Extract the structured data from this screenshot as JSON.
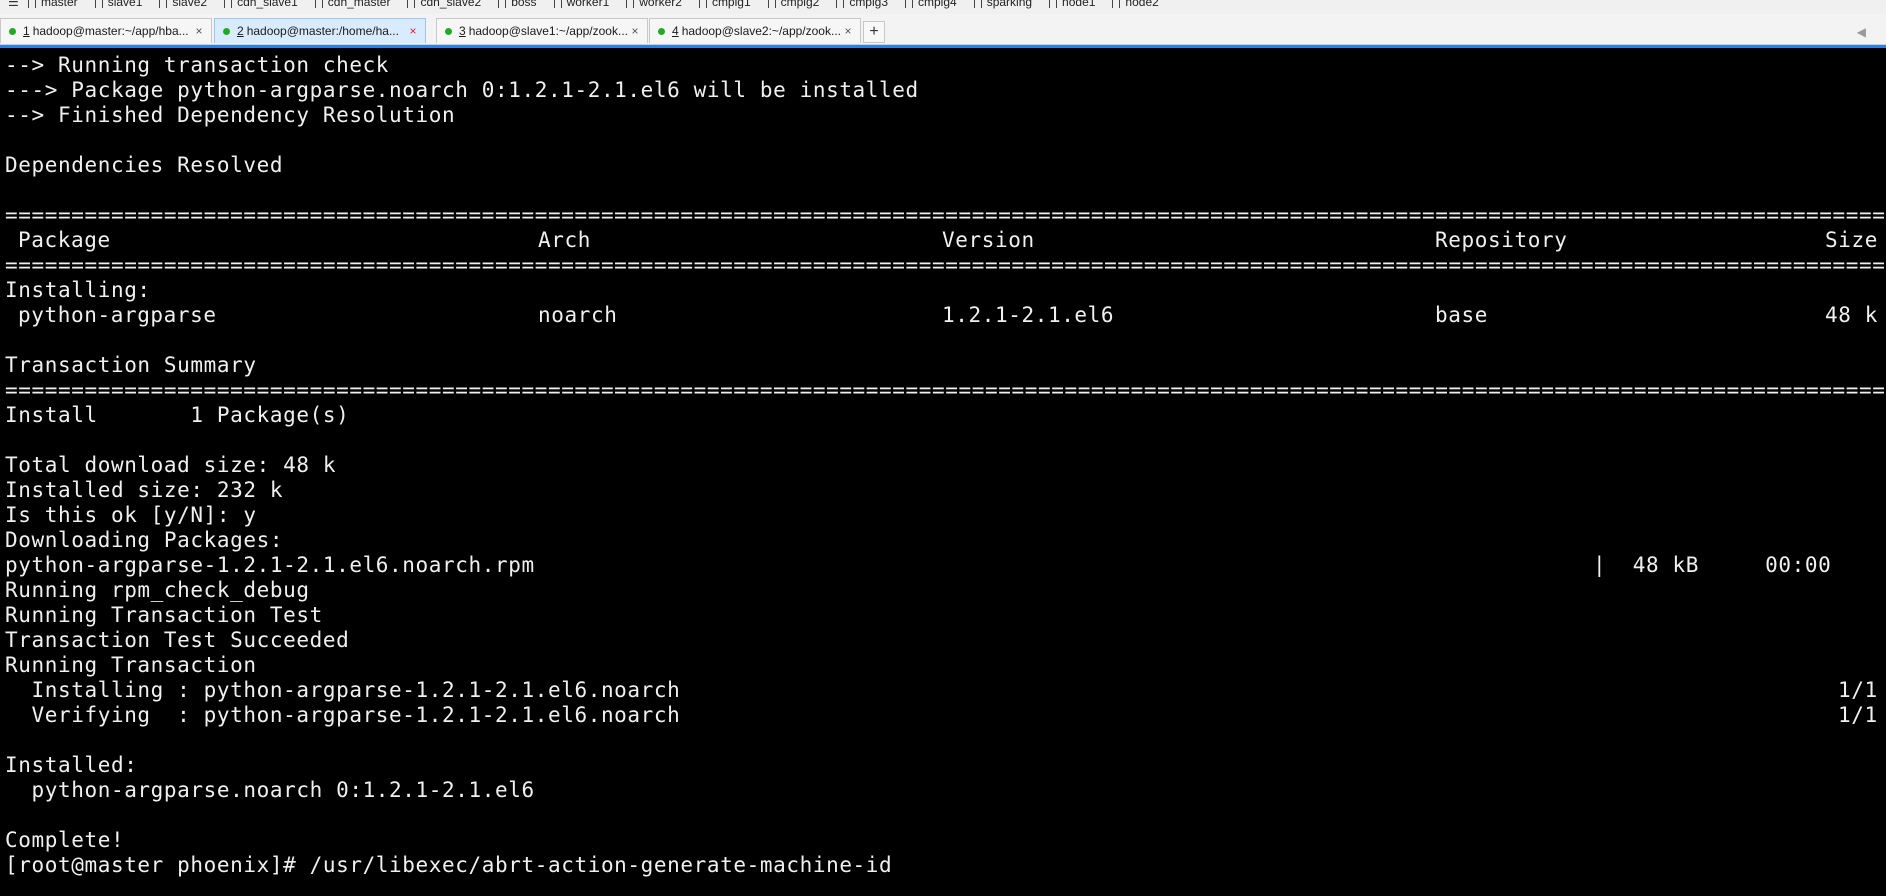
{
  "bookmarks": {
    "items": [
      {
        "label": "master"
      },
      {
        "label": "slave1"
      },
      {
        "label": "slave2"
      },
      {
        "label": "cdh_slave1"
      },
      {
        "label": "cdh_master"
      },
      {
        "label": "cdh_slave2"
      },
      {
        "label": "boss"
      },
      {
        "label": "worker1"
      },
      {
        "label": "worker2"
      },
      {
        "label": "cmpig1"
      },
      {
        "label": "cmpig2"
      },
      {
        "label": "cmpig3"
      },
      {
        "label": "cmpig4"
      },
      {
        "label": "sparking"
      },
      {
        "label": "node1"
      },
      {
        "label": "node2"
      }
    ]
  },
  "tabs": [
    {
      "num": "1",
      "title": "hadoop@master:~/app/hba...",
      "status_color": "#22aa22",
      "active": false
    },
    {
      "num": "2",
      "title": "hadoop@master:/home/ha...",
      "status_color": "#22aa22",
      "active": true
    },
    {
      "num": "3",
      "title": "hadoop@slave1:~/app/zook...",
      "status_color": "#22aa22",
      "active": false
    },
    {
      "num": "4",
      "title": "hadoop@slave2:~/app/zook...",
      "status_color": "#22aa22",
      "active": false
    }
  ],
  "tab_close_symbol": "×",
  "add_tab_symbol": "+",
  "colors": {
    "terminal_bg": "#000000",
    "terminal_fg": "#f0f0f0",
    "accent": "#2a82e4",
    "status_connected": "#22aa22"
  },
  "terminal": {
    "lines": {
      "l01": "--> Running transaction check",
      "l02": "---> Package python-argparse.noarch 0:1.2.1-2.1.el6 will be installed",
      "l03": "--> Finished Dependency Resolution",
      "l05": "Dependencies Resolved",
      "separator": "==========================================================================================================================================================================",
      "header": {
        "package": "Package",
        "arch": "Arch",
        "version": "Version",
        "repository": "Repository",
        "size": "Size"
      },
      "installing_label": "Installing:",
      "package_row": {
        "package": "python-argparse",
        "arch": "noarch",
        "version": "1.2.1-2.1.el6",
        "repository": "base",
        "size": "48 k"
      },
      "transaction_summary": "Transaction Summary",
      "install_count": "Install       1 Package(s)",
      "total_download": "Total download size: 48 k",
      "installed_size": "Installed size: 232 k",
      "confirm_prompt": "Is this ok [y/N]: y",
      "downloading": "Downloading Packages:",
      "rpm_file": "python-argparse-1.2.1-2.1.el6.noarch.rpm",
      "rpm_progress": "|  48 kB     00:00",
      "rpm_check": "Running rpm_check_debug",
      "test": "Running Transaction Test",
      "test_ok": "Transaction Test Succeeded",
      "running": "Running Transaction",
      "installing_step": "  Installing : python-argparse-1.2.1-2.1.el6.noarch",
      "installing_count": "1/1",
      "verifying_step": "  Verifying  : python-argparse-1.2.1-2.1.el6.noarch",
      "verifying_count": "1/1",
      "installed_label": "Installed:",
      "installed_pkg": "  python-argparse.noarch 0:1.2.1-2.1.el6",
      "complete": "Complete!",
      "prompt": "[root@master phoenix]# /usr/libexec/abrt-action-generate-machine-id"
    }
  }
}
